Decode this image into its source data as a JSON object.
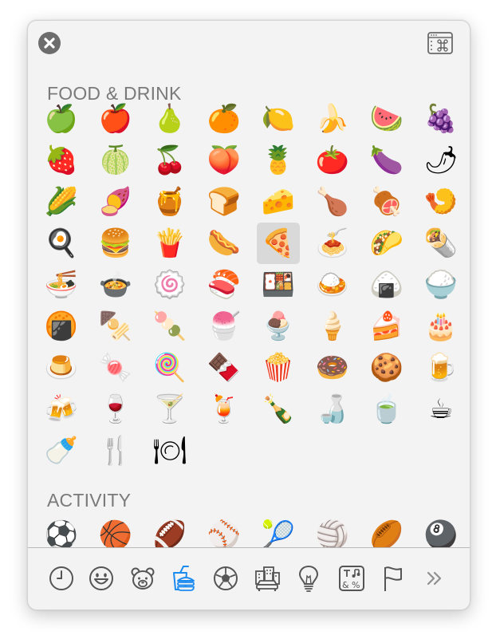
{
  "sections": [
    {
      "title": "FOOD & DRINK",
      "emojis": [
        "green-apple",
        "red-apple",
        "pear",
        "tangerine",
        "lemon",
        "banana",
        "watermelon",
        "grapes",
        "strawberry",
        "melon",
        "cherries",
        "peach",
        "pineapple",
        "tomato",
        "eggplant",
        "hot-pepper",
        "corn",
        "sweet-potato",
        "honey-pot",
        "bread",
        "cheese",
        "poultry-leg",
        "meat-on-bone",
        "fried-shrimp",
        "cooking",
        "hamburger",
        "french-fries",
        "hot-dog",
        "pizza",
        "spaghetti",
        "taco",
        "burrito",
        "ramen",
        "stew",
        "fish-cake",
        "sushi",
        "bento",
        "curry",
        "rice-ball",
        "cooked-rice",
        "rice-cracker",
        "oden",
        "dango",
        "shaved-ice",
        "ice-cream",
        "soft-ice-cream",
        "shortcake",
        "birthday-cake",
        "custard",
        "candy",
        "lollipop",
        "chocolate-bar",
        "popcorn",
        "doughnut",
        "cookie",
        "beer",
        "beers",
        "wine-glass",
        "cocktail",
        "tropical-drink",
        "champagne",
        "sake",
        "tea",
        "coffee",
        "baby-bottle",
        "fork-and-knife",
        "fork-knife-plate"
      ],
      "selected_index": 28
    },
    {
      "title": "ACTIVITY",
      "emojis": [
        "soccer",
        "basketball",
        "football",
        "baseball",
        "tennis",
        "volleyball",
        "rugby",
        "billiards"
      ]
    }
  ],
  "glyphs": {
    "green-apple": "🍏",
    "red-apple": "🍎",
    "pear": "🍐",
    "tangerine": "🍊",
    "lemon": "🍋",
    "banana": "🍌",
    "watermelon": "🍉",
    "grapes": "🍇",
    "strawberry": "🍓",
    "melon": "🍈",
    "cherries": "🍒",
    "peach": "🍑",
    "pineapple": "🍍",
    "tomato": "🍅",
    "eggplant": "🍆",
    "hot-pepper": "🌶",
    "corn": "🌽",
    "sweet-potato": "🍠",
    "honey-pot": "🍯",
    "bread": "🍞",
    "cheese": "🧀",
    "poultry-leg": "🍗",
    "meat-on-bone": "🍖",
    "fried-shrimp": "🍤",
    "cooking": "🍳",
    "hamburger": "🍔",
    "french-fries": "🍟",
    "hot-dog": "🌭",
    "pizza": "🍕",
    "spaghetti": "🍝",
    "taco": "🌮",
    "burrito": "🌯",
    "ramen": "🍜",
    "stew": "🍲",
    "fish-cake": "🍥",
    "sushi": "🍣",
    "bento": "🍱",
    "curry": "🍛",
    "rice-ball": "🍙",
    "cooked-rice": "🍚",
    "rice-cracker": "🍘",
    "oden": "🍢",
    "dango": "🍡",
    "shaved-ice": "🍧",
    "ice-cream": "🍨",
    "soft-ice-cream": "🍦",
    "shortcake": "🍰",
    "birthday-cake": "🎂",
    "custard": "🍮",
    "candy": "🍬",
    "lollipop": "🍭",
    "chocolate-bar": "🍫",
    "popcorn": "🍿",
    "doughnut": "🍩",
    "cookie": "🍪",
    "beer": "🍺",
    "beers": "🍻",
    "wine-glass": "🍷",
    "cocktail": "🍸",
    "tropical-drink": "🍹",
    "champagne": "🍾",
    "sake": "🍶",
    "tea": "🍵",
    "coffee": "☕",
    "baby-bottle": "🍼",
    "fork-and-knife": "🍴",
    "fork-knife-plate": "🍽",
    "soccer": "⚽",
    "basketball": "🏀",
    "football": "🏈",
    "baseball": "⚾",
    "tennis": "🎾",
    "volleyball": "🏐",
    "rugby": "🏉",
    "billiards": "🎱"
  },
  "categories": [
    {
      "name": "frequently-used",
      "icon": "clock-icon",
      "active": false
    },
    {
      "name": "smileys-people",
      "icon": "smiley-icon",
      "active": false
    },
    {
      "name": "animals-nature",
      "icon": "bear-icon",
      "active": false
    },
    {
      "name": "food-drink",
      "icon": "food-drink-icon",
      "active": true
    },
    {
      "name": "activity",
      "icon": "soccer-ball-icon",
      "active": false
    },
    {
      "name": "travel-places",
      "icon": "buildings-car-icon",
      "active": false
    },
    {
      "name": "objects",
      "icon": "lightbulb-icon",
      "active": false
    },
    {
      "name": "symbols",
      "icon": "symbols-icon",
      "active": false
    },
    {
      "name": "flags",
      "icon": "flag-icon",
      "active": false
    },
    {
      "name": "more",
      "icon": "chevron-double-right-icon",
      "active": false
    }
  ],
  "colors": {
    "panel_bg": "#f3f3f3",
    "icon_gray": "#555555",
    "accent_blue": "#1b8bf0",
    "title_gray": "#7a7a7a",
    "selected_bg": "#d9d9d9"
  }
}
